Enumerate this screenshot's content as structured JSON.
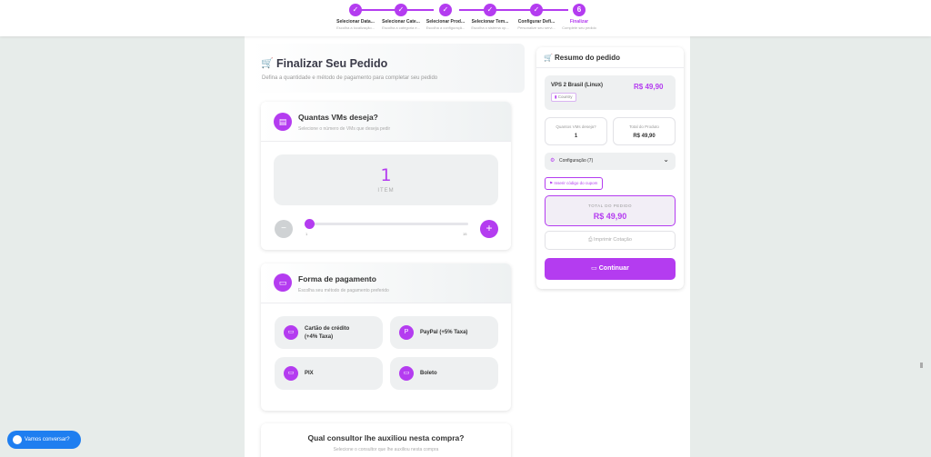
{
  "stepper": {
    "steps": [
      {
        "label": "Selecionar Data...",
        "sub": "Escolha a localização...",
        "mark": "✓"
      },
      {
        "label": "Selecionar Cate...",
        "sub": "Escolha a categoria e...",
        "mark": "✓"
      },
      {
        "label": "Selecionar Prod...",
        "sub": "Escolha a configuraçã...",
        "mark": "✓"
      },
      {
        "label": "Selecionar Tem...",
        "sub": "Escolha o sistema op...",
        "mark": "✓"
      },
      {
        "label": "Configurar Defi...",
        "sub": "Personalize seu servi...",
        "mark": "✓"
      },
      {
        "label": "Finalizar",
        "sub": "Complete seu pedido",
        "mark": "6"
      }
    ]
  },
  "page": {
    "title": "Finalizar Seu Pedido",
    "subtitle": "Defina a quantidade e método de pagamento para completar seu pedido"
  },
  "quantity": {
    "title": "Quantas VMs deseja?",
    "subtitle": "Selecione o número de VMs que deseja pedir",
    "value": "1",
    "unit": "ITEM",
    "min_label": "1",
    "max_label": "15",
    "minus": "−",
    "plus": "+"
  },
  "payment": {
    "title": "Forma de pagamento",
    "subtitle": "Escolha seu método de pagamento preferido",
    "options": [
      {
        "line1": "Cartão de crédito",
        "line2": "(+4% Taxa)"
      },
      {
        "line1": "PayPal (+5% Taxa)",
        "line2": ""
      },
      {
        "line1": "PIX",
        "line2": ""
      },
      {
        "line1": "Boleto",
        "line2": ""
      }
    ]
  },
  "consultant": {
    "title": "Qual consultor lhe auxiliou nesta compra?",
    "subtitle": "Selecione o consultor que lhe auxiliou nesta compra"
  },
  "summary": {
    "title": "Resumo do pedido",
    "product_name": "VPS 2 Brasil (Linux)",
    "product_price": "R$ 49,90",
    "product_badge": "Country",
    "qty_label": "Quantos VMs deseja?",
    "qty_value": "1",
    "total_products_label": "Total do Produto",
    "total_products_value": "R$ 49,90",
    "config_label": "Configuração (7)",
    "coupon_label": "Inserir código do cupom",
    "total_label": "TOTAL DO PEDIDO",
    "total_value": "R$ 49,90",
    "print_label": "Imprimir Cotação",
    "continue_label": "Continuar"
  },
  "chat": {
    "label": "Vamos conversar?"
  },
  "colors": {
    "accent": "#b43cf0",
    "chat": "#1e7ef0"
  }
}
